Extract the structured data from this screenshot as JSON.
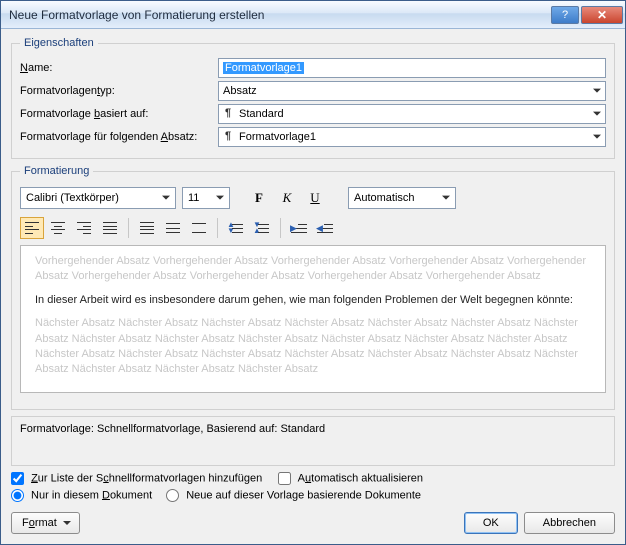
{
  "window": {
    "title": "Neue Formatvorlage von Formatierung erstellen"
  },
  "groups": {
    "props": "Eigenschaften",
    "fmt": "Formatierung"
  },
  "props": {
    "name_label": "Name:",
    "name_value": "Formatvorlage1",
    "type_label": "Formatvorlagentyp:",
    "type_value": "Absatz",
    "based_label": "Formatvorlage basiert auf:",
    "based_value": "Standard",
    "next_label": "Formatvorlage für folgenden Absatz:",
    "next_value": "Formatvorlage1"
  },
  "fmt": {
    "font": "Calibri (Textkörper)",
    "size": "11",
    "bold": "F",
    "italic": "K",
    "underline": "U",
    "color": "Automatisch"
  },
  "preview": {
    "before": "Vorhergehender Absatz Vorhergehender Absatz Vorhergehender Absatz Vorhergehender Absatz Vorhergehender Absatz Vorhergehender Absatz Vorhergehender Absatz Vorhergehender Absatz Vorhergehender Absatz",
    "sample": "In dieser Arbeit wird es insbesondere darum gehen, wie man folgenden Problemen der Welt begegnen könnte:",
    "after": "Nächster Absatz Nächster Absatz Nächster Absatz Nächster Absatz Nächster Absatz Nächster Absatz Nächster Absatz Nächster Absatz Nächster Absatz Nächster Absatz Nächster Absatz Nächster Absatz Nächster Absatz Nächster Absatz Nächster Absatz Nächster Absatz Nächster Absatz Nächster Absatz Nächster Absatz Nächster Absatz Nächster Absatz Nächster Absatz Nächster Absatz"
  },
  "desc": "Formatvorlage: Schnellformatvorlage, Basierend auf: Standard",
  "opts": {
    "quick": "Zur Liste der Schnellformatvorlagen hinzufügen",
    "auto": "Automatisch aktualisieren",
    "thisdoc": "Nur in diesem Dokument",
    "template": "Neue auf dieser Vorlage basierende Dokumente"
  },
  "buttons": {
    "format": "Format",
    "ok": "OK",
    "cancel": "Abbrechen"
  },
  "pil": "¶"
}
